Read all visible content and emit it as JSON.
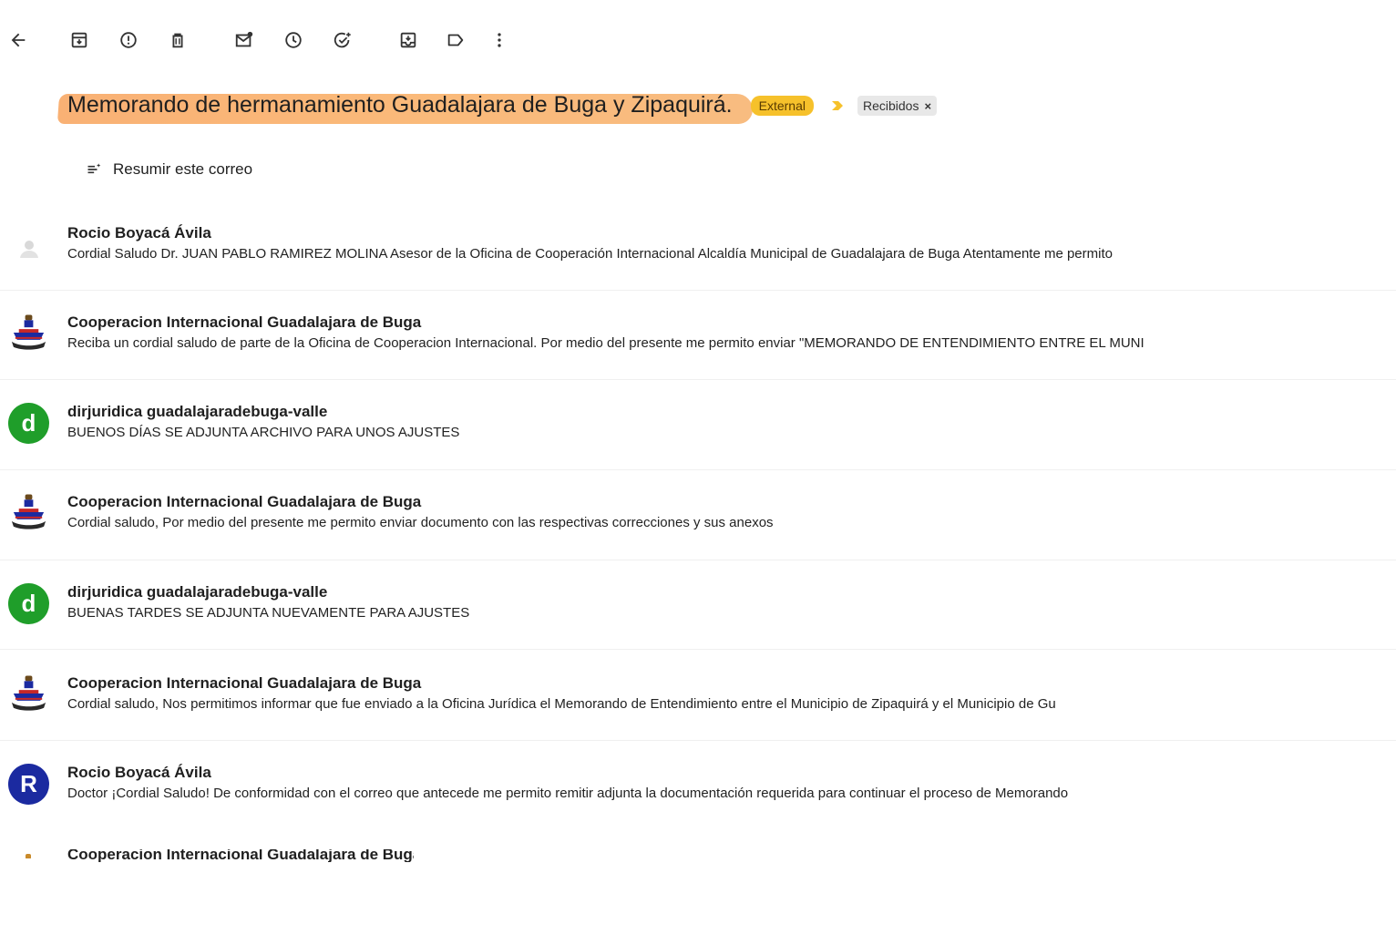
{
  "toolbar": {
    "icons": [
      "back-arrow-icon",
      "archive-icon",
      "report-spam-icon",
      "delete-icon",
      "mark-unread-icon",
      "snooze-icon",
      "add-task-icon",
      "move-to-icon",
      "label-icon",
      "more-vert-icon"
    ]
  },
  "thread": {
    "subject": "Memorando de hermanamiento Guadalajara de Buga y Zipaquirá.",
    "external_badge": "External",
    "label_chip": "Recibidos",
    "label_chip_close": "×",
    "highlight_color": "#f8a35c",
    "external_color": "#f6c12b"
  },
  "summarize": {
    "label": "Resumir este correo"
  },
  "messages": [
    {
      "sender": "Rocio Boyacá Ávila",
      "snippet": "Cordial Saludo Dr. JUAN PABLO RAMIREZ MOLINA Asesor de la Oficina de Cooperación Internacional Alcaldía Municipal de Guadalajara de Buga Atentamente me permito",
      "avatar_type": "person-silhouette"
    },
    {
      "sender": "Cooperacion Internacional Guadalajara de Buga",
      "snippet": "Reciba un cordial saludo de parte de la Oficina de Cooperacion Internacional. Por medio del presente me permito enviar \"MEMORANDO DE ENTENDIMIENTO ENTRE EL MUNI",
      "avatar_type": "crest"
    },
    {
      "sender": "dirjuridica guadalajaradebuga-valle",
      "snippet": "BUENOS DÍAS SE ADJUNTA ARCHIVO PARA UNOS AJUSTES",
      "avatar_letter": "d",
      "avatar_color": "#1f9e2a"
    },
    {
      "sender": "Cooperacion Internacional Guadalajara de Buga",
      "snippet": "Cordial saludo, Por medio del presente me permito enviar documento con las respectivas correcciones y sus anexos",
      "avatar_type": "crest"
    },
    {
      "sender": "dirjuridica guadalajaradebuga-valle",
      "snippet": "BUENAS TARDES SE ADJUNTA NUEVAMENTE PARA AJUSTES",
      "avatar_letter": "d",
      "avatar_color": "#1f9e2a"
    },
    {
      "sender": "Cooperacion Internacional Guadalajara de Buga",
      "snippet": "Cordial saludo, Nos permitimos informar que fue enviado a la Oficina Jurídica el Memorando de Entendimiento entre el Municipio de Zipaquirá y el Municipio de Gu",
      "avatar_type": "crest"
    },
    {
      "sender": "Rocio Boyacá Ávila",
      "snippet": "Doctor ¡Cordial Saludo! De conformidad con el correo que antecede me permito remitir adjunta la documentación requerida para continuar el proceso de Memorando",
      "avatar_letter": "R",
      "avatar_color": "#1b2aa0"
    },
    {
      "sender": "Cooperacion Internacional Guadalajara de Buga",
      "snippet": "",
      "avatar_type": "crest",
      "partial": true
    }
  ]
}
